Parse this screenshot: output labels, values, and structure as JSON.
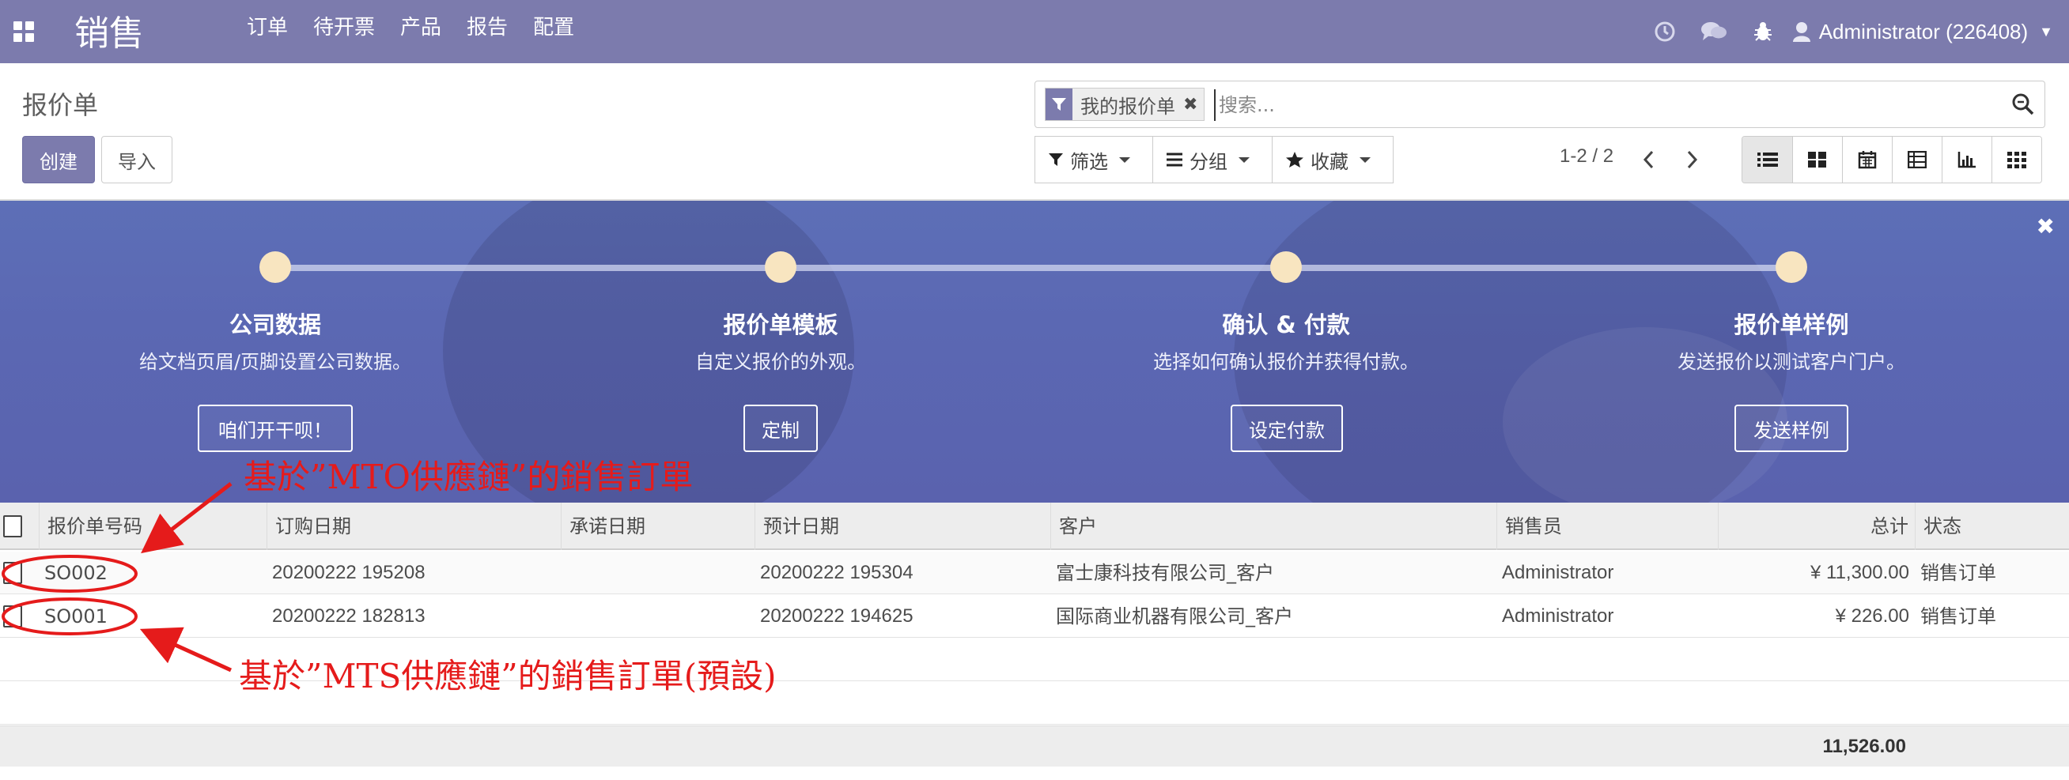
{
  "navbar": {
    "brand": "销售",
    "menu": [
      "订单",
      "待开票",
      "产品",
      "报告",
      "配置"
    ],
    "user": "Administrator (226408)"
  },
  "control_panel": {
    "breadcrumb": "报价单",
    "create_label": "创建",
    "import_label": "导入",
    "facet_label": "我的报价单",
    "search_placeholder": "搜索...",
    "filter_label": "筛选",
    "group_label": "分组",
    "favorites_label": "收藏",
    "pager": "1-2 / 2"
  },
  "onboarding": {
    "steps": [
      {
        "title": "公司数据",
        "desc": "给文档页眉/页脚设置公司数据。",
        "button": "咱们开干呗！"
      },
      {
        "title": "报价单模板",
        "desc": "自定义报价的外观。",
        "button": "定制"
      },
      {
        "title": "确认 & 付款",
        "desc": "选择如何确认报价并获得付款。",
        "button": "设定付款"
      },
      {
        "title": "报价单样例",
        "desc": "发送报价以测试客户门户。",
        "button": "发送样例"
      }
    ]
  },
  "annotations": {
    "mto": "基於”MTO供應鏈”的銷售訂單",
    "mts": "基於”MTS供應鏈”的銷售訂單(預設)",
    "color": "#e51b1b"
  },
  "table": {
    "columns": [
      "报价单号码",
      "订购日期",
      "承诺日期",
      "预计日期",
      "客户",
      "销售员",
      "总计",
      "状态"
    ],
    "rows": [
      {
        "number": "SO002",
        "order_date": "20200222 195208",
        "commitment_date": "",
        "expected_date": "20200222 195304",
        "customer": "富士康科技有限公司_客户",
        "salesperson": "Administrator",
        "total": "¥ 11,300.00",
        "status": "销售订单"
      },
      {
        "number": "SO001",
        "order_date": "20200222 182813",
        "commitment_date": "",
        "expected_date": "20200222 194625",
        "customer": "国际商业机器有限公司_客户",
        "salesperson": "Administrator",
        "total": "¥ 226.00",
        "status": "销售订单"
      }
    ],
    "footer_total": "11,526.00"
  },
  "colors": {
    "primary": "#7c7bad",
    "banner": "#5b68b3",
    "step_dot": "#f8e5c0"
  }
}
